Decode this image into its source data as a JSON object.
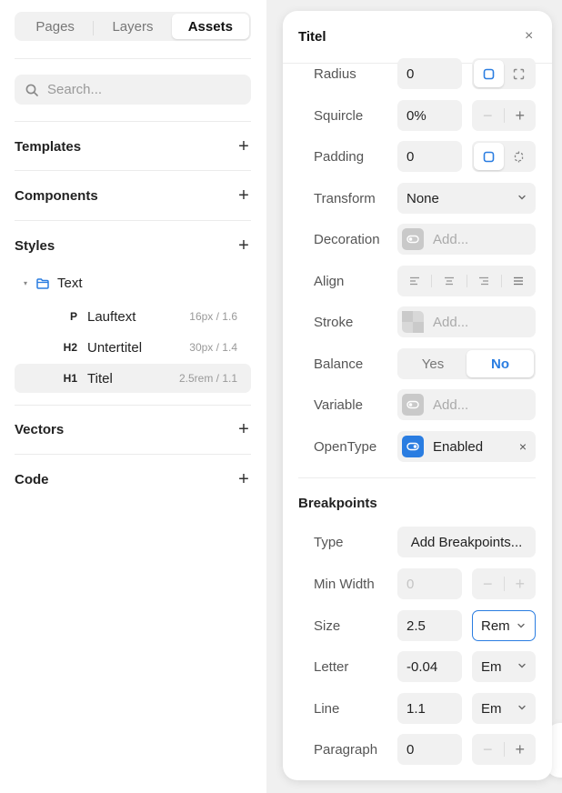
{
  "left": {
    "tabs": [
      "Pages",
      "Layers",
      "Assets"
    ],
    "search_placeholder": "Search...",
    "sections": {
      "templates": "Templates",
      "components": "Components",
      "styles": "Styles",
      "vectors": "Vectors",
      "code": "Code"
    },
    "folder": "Text",
    "styles": [
      {
        "tag": "P",
        "name": "Lauftext",
        "value": "16px / 1.6"
      },
      {
        "tag": "H2",
        "name": "Untertitel",
        "value": "30px / 1.4"
      },
      {
        "tag": "H1",
        "name": "Titel",
        "value": "2.5rem / 1.1"
      }
    ]
  },
  "panel": {
    "title": "Titel",
    "close": "×",
    "radius": {
      "label": "Radius",
      "value": "0"
    },
    "squircle": {
      "label": "Squircle",
      "value": "0%"
    },
    "padding": {
      "label": "Padding",
      "value": "0"
    },
    "transform": {
      "label": "Transform",
      "value": "None"
    },
    "decoration": {
      "label": "Decoration",
      "placeholder": "Add..."
    },
    "align": {
      "label": "Align"
    },
    "stroke": {
      "label": "Stroke",
      "placeholder": "Add..."
    },
    "balance": {
      "label": "Balance",
      "options": [
        "Yes",
        "No"
      ],
      "selected": "No"
    },
    "variable": {
      "label": "Variable",
      "placeholder": "Add..."
    },
    "opentype": {
      "label": "OpenType",
      "value": "Enabled",
      "remove": "×"
    },
    "breakpoints": {
      "title": "Breakpoints",
      "type": {
        "label": "Type",
        "button": "Add Breakpoints..."
      },
      "min_width": {
        "label": "Min Width",
        "placeholder": "0"
      },
      "size": {
        "label": "Size",
        "value": "2.5",
        "unit": "Rem"
      },
      "letter": {
        "label": "Letter",
        "value": "-0.04",
        "unit": "Em"
      },
      "line": {
        "label": "Line",
        "value": "1.1",
        "unit": "Em"
      },
      "paragraph": {
        "label": "Paragraph",
        "value": "0"
      }
    },
    "stepper": {
      "minus": "−",
      "plus": "+"
    }
  },
  "colors": {
    "accent": "#2a7de1",
    "panel_bg": "#f0f0f0",
    "field_bg": "#f1f1f1"
  },
  "icons": [
    "search-icon",
    "folder-icon",
    "plus-icon",
    "close-icon",
    "chevron-down-icon",
    "corner-square-icon",
    "corner-expand-icon",
    "padding-square-icon",
    "padding-dashed-icon",
    "toggle-icon",
    "align-left-icon",
    "align-center-icon",
    "align-right-icon",
    "align-justify-icon"
  ]
}
